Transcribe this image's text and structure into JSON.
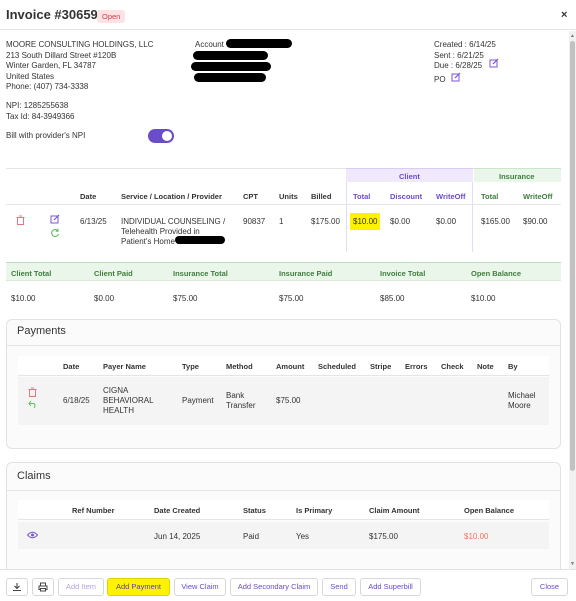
{
  "header": {
    "title": "Invoice #30659",
    "status": "Open",
    "close_glyph": "×"
  },
  "provider": {
    "name": "MOORE CONSULTING HOLDINGS, LLC",
    "address1": "213 South Dillard Street #120B",
    "address2": "Winter Garden, FL 34787",
    "country": "United States",
    "phone": "Phone: (407) 734-3338",
    "npi": "NPI: 1285255638",
    "tax_id": "Tax Id: 84-3949366"
  },
  "account_label": "Account",
  "dates": {
    "created": "Created : 6/14/25",
    "sent": "Sent : 6/21/25",
    "due": "Due : 6/28/25",
    "po": "PO"
  },
  "npi_toggle": {
    "label": "Bill with provider's NPI",
    "on": true
  },
  "services": {
    "group_client": "Client",
    "group_insurance": "Insurance",
    "headers": [
      "Date",
      "Service / Location / Provider",
      "CPT",
      "Units",
      "Billed",
      "Total",
      "Discount",
      "WriteOff",
      "Total",
      "WriteOff"
    ],
    "row": {
      "date": "6/13/25",
      "service_line1": "INDIVIDUAL COUNSELING /",
      "service_line2": "Telehealth Provided in",
      "service_line3": "Patient's Home /",
      "cpt": "90837",
      "units": "1",
      "billed": "$175.00",
      "client_total": "$10.00",
      "client_discount": "$0.00",
      "client_writeoff": "$0.00",
      "ins_total": "$165.00",
      "ins_writeoff": "$90.00"
    }
  },
  "summary": {
    "headers": [
      "Client Total",
      "Client Paid",
      "Insurance Total",
      "Insurance Paid",
      "Invoice Total",
      "Open Balance"
    ],
    "values": [
      "$10.00",
      "$0.00",
      "$75.00",
      "$75.00",
      "$85.00",
      "$10.00"
    ]
  },
  "payments": {
    "title": "Payments",
    "headers": [
      "Date",
      "Payer Name",
      "Type",
      "Method",
      "Amount",
      "Scheduled",
      "Stripe",
      "Errors",
      "Check",
      "Note",
      "By"
    ],
    "row": {
      "date": "6/18/25",
      "payer_line1": "CIGNA",
      "payer_line2": "BEHAVIORAL",
      "payer_line3": "HEALTH",
      "type": "Payment",
      "method_line1": "Bank",
      "method_line2": "Transfer",
      "amount": "$75.00",
      "by_line1": "Michael",
      "by_line2": "Moore"
    }
  },
  "claims": {
    "title": "Claims",
    "headers": [
      "Ref Number",
      "Date Created",
      "Status",
      "Is Primary",
      "Claim Amount",
      "Open Balance"
    ],
    "row": {
      "date_created": "Jun 14, 2025",
      "status": "Paid",
      "is_primary": "Yes",
      "claim_amount": "$175.00",
      "open_balance": "$10.00"
    }
  },
  "footer": {
    "add_item": "Add Item",
    "add_payment": "Add Payment",
    "view_claim": "View Claim",
    "add_secondary_claim": "Add Secondary Claim",
    "send": "Send",
    "add_superbill": "Add Superbill",
    "close": "Close"
  },
  "colors": {
    "accent": "#6b4cc9",
    "status_red": "#d43c52",
    "highlight": "#fff200",
    "summary_green": "#3e7e3e"
  }
}
